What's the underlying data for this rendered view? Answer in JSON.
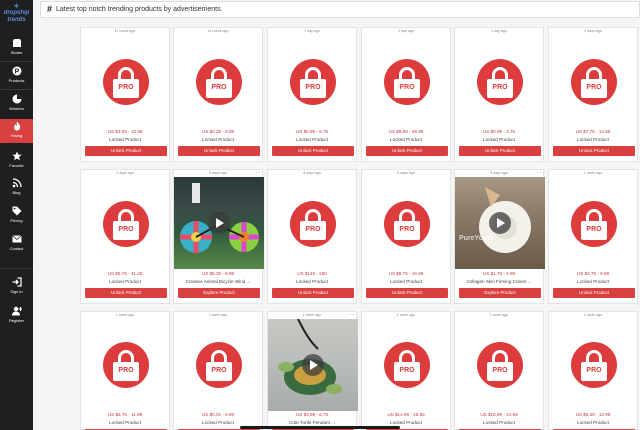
{
  "sidebar": {
    "brand": "dropship trends",
    "items": [
      {
        "label": "Stores",
        "icon": "store-icon"
      },
      {
        "label": "Products",
        "icon": "products-icon"
      },
      {
        "label": "Winners",
        "icon": "pie-chart-icon"
      },
      {
        "label": "Rising",
        "icon": "flame-icon",
        "active": true
      },
      {
        "label": "Favorite",
        "icon": "star-icon"
      },
      {
        "label": "Blog",
        "icon": "rss-icon"
      },
      {
        "label": "Pricing",
        "icon": "tags-icon"
      },
      {
        "label": "Contact",
        "icon": "envelope-icon"
      },
      {
        "label": "Sign in",
        "icon": "sign-in-icon"
      },
      {
        "label": "Register",
        "icon": "add-user-icon"
      }
    ]
  },
  "banner": {
    "hash": "#",
    "text": "Latest top notch trending products by advertisements."
  },
  "colors": {
    "accent": "#d94040",
    "sidebar": "#1f1f1f"
  },
  "cards": [
    {
      "time": "11 hours ago",
      "price": "US $3.99 - 13.99",
      "name": "Locked Product",
      "button": "Unlock Product"
    },
    {
      "time": "14 hours ago",
      "price": "US $0.25 - 8.99",
      "name": "Locked Product",
      "button": "Unlock Product"
    },
    {
      "time": "1 day ago",
      "price": "US $0.89 - 8.79",
      "name": "Locked Product",
      "button": "Unlock Product"
    },
    {
      "time": "1 day ago",
      "price": "US $8.99 - 39.99",
      "name": "Locked Product",
      "button": "Unlock Product"
    },
    {
      "time": "1 day ago",
      "price": "US $0.99 - 4.75",
      "name": "Locked Product",
      "button": "Unlock Product"
    },
    {
      "time": "2 days ago",
      "price": "US $7.75 - 14.95",
      "name": "Locked Product",
      "button": "Unlock Product"
    },
    {
      "time": "3 days ago",
      "price": "US $8.75 - 31.25",
      "name": "Locked Product",
      "button": "Unlock Product"
    },
    {
      "time": "5 days ago",
      "price": "US $5.35 - 8.99",
      "name": "Creative Animal Bicycle Wind ...",
      "button": "Explore Product",
      "thumb": "thumb1"
    },
    {
      "time": "6 days ago",
      "price": "US $145 - 250",
      "name": "Locked Product",
      "button": "Unlock Product"
    },
    {
      "time": "6 days ago",
      "price": "US $8.75 - 16.99",
      "name": "Locked Product",
      "button": "Unlock Product"
    },
    {
      "time": "6 days ago",
      "price": "US $1.75 - 4.99",
      "name": "Collagen Skin Firming Cream ...",
      "button": "Explore Product",
      "thumb": "thumb2",
      "watermark": "PureYouth"
    },
    {
      "time": "1 week ago",
      "price": "US $2.75 - 9.99",
      "name": "Locked Product",
      "button": "Unlock Product"
    },
    {
      "time": "1 week ago",
      "price": "US $6.75 - 11.99",
      "name": "Locked Product",
      "button": "Unlock Product"
    },
    {
      "time": "1 week ago",
      "price": "US $0.01 - 6.99",
      "name": "Locked Product",
      "button": "Unlock Product"
    },
    {
      "time": "1 week ago",
      "price": "US $3.99 - 6.75",
      "name": "Cute Turtle Pendant ...",
      "button": "Explore Product",
      "thumb": "thumb3"
    },
    {
      "time": "1 week ago",
      "price": "US $14.99 - 25.95",
      "name": "Locked Product",
      "button": "Unlock Product"
    },
    {
      "time": "1 week ago",
      "price": "US $15.99 - 21.99",
      "name": "Locked Product",
      "button": "Unlock Product"
    },
    {
      "time": "1 week ago",
      "price": "US $6.35 - 13.99",
      "name": "Locked Product",
      "button": "Unlock Product"
    }
  ],
  "pro_badge": "PRO"
}
